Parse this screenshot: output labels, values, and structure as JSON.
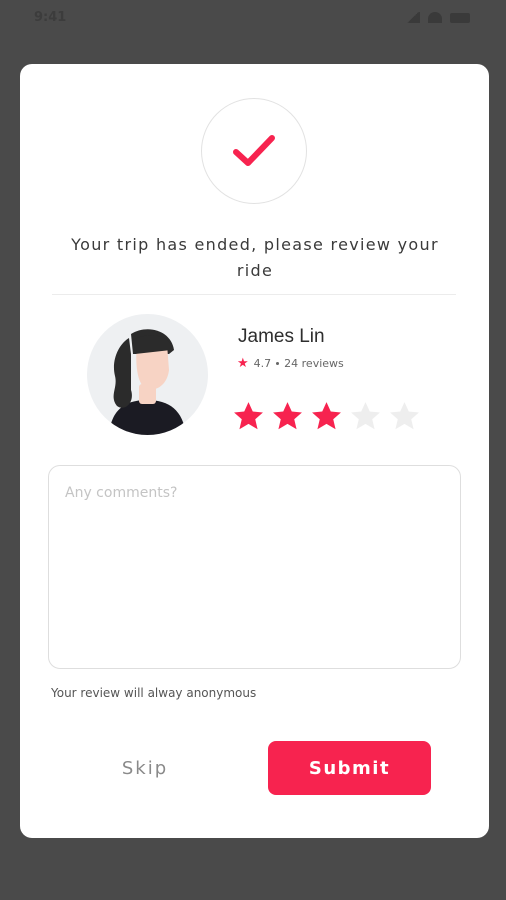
{
  "status_bar": {
    "time": "9:41"
  },
  "modal": {
    "title": "Your trip has ended, please review your ride",
    "driver": {
      "name": "James Lin",
      "rating": "4.7",
      "reviews": "24 reviews"
    },
    "user_rating": {
      "value": 3,
      "max": 5
    },
    "comments": {
      "placeholder": "Any comments?",
      "value": ""
    },
    "anonymous_note": "Your review will alway anonymous",
    "skip_label": "Skip",
    "submit_label": "Submit"
  },
  "colors": {
    "accent": "#f7234f",
    "inactive_star": "#eeeeee",
    "overlay": "#4a4a4a"
  },
  "icons": {
    "success": "check-icon",
    "rating": "star-icon"
  }
}
